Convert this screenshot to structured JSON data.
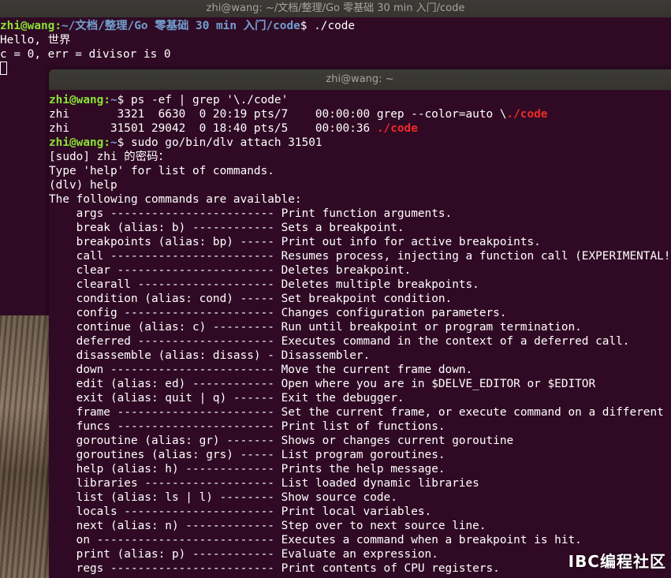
{
  "back_window": {
    "title": "zhi@wang: ~/文档/整理/Go 零基础 30 min 入门/code",
    "prompt_user": "zhi@wang",
    "prompt_path": "~/文档/整理/Go 零基础 30 min 入门/code",
    "command": " ./code",
    "output": [
      "Hello, 世界",
      "c = 0, err = divisor is 0"
    ]
  },
  "front_window": {
    "title": "zhi@wang: ~",
    "prompt_user": "zhi@wang",
    "prompt_path": "~",
    "cmd1": " ps -ef | grep '\\./code'",
    "ps_row1_prefix": "zhi       3321  6630  0 20:19 pts/7    00:00:00 grep --color=auto \\",
    "ps_row1_match": "./code",
    "ps_row2_prefix": "zhi      31501 29042  0 18:40 pts/5    00:00:36 ",
    "ps_row2_match": "./code",
    "cmd2": " sudo go/bin/dlv attach 31501",
    "lines": [
      "[sudo] zhi 的密码：",
      "Type 'help' for list of commands.",
      "(dlv) help",
      "The following commands are available:"
    ],
    "commands": [
      {
        "name": "args ------------------------",
        "desc": "Print function arguments."
      },
      {
        "name": "break (alias: b) ------------",
        "desc": "Sets a breakpoint."
      },
      {
        "name": "breakpoints (alias: bp) -----",
        "desc": "Print out info for active breakpoints."
      },
      {
        "name": "call ------------------------",
        "desc": "Resumes process, injecting a function call (EXPERIMENTAL!!!)"
      },
      {
        "name": "clear -----------------------",
        "desc": "Deletes breakpoint."
      },
      {
        "name": "clearall --------------------",
        "desc": "Deletes multiple breakpoints."
      },
      {
        "name": "condition (alias: cond) -----",
        "desc": "Set breakpoint condition."
      },
      {
        "name": "config ----------------------",
        "desc": "Changes configuration parameters."
      },
      {
        "name": "continue (alias: c) ---------",
        "desc": "Run until breakpoint or program termination."
      },
      {
        "name": "deferred --------------------",
        "desc": "Executes command in the context of a deferred call."
      },
      {
        "name": "disassemble (alias: disass) -",
        "desc": "Disassembler."
      },
      {
        "name": "down ------------------------",
        "desc": "Move the current frame down."
      },
      {
        "name": "edit (alias: ed) ------------",
        "desc": "Open where you are in $DELVE_EDITOR or $EDITOR"
      },
      {
        "name": "exit (alias: quit | q) ------",
        "desc": "Exit the debugger."
      },
      {
        "name": "frame -----------------------",
        "desc": "Set the current frame, or execute command on a different frame."
      },
      {
        "name": "funcs -----------------------",
        "desc": "Print list of functions."
      },
      {
        "name": "goroutine (alias: gr) -------",
        "desc": "Shows or changes current goroutine"
      },
      {
        "name": "goroutines (alias: grs) -----",
        "desc": "List program goroutines."
      },
      {
        "name": "help (alias: h) -------------",
        "desc": "Prints the help message."
      },
      {
        "name": "libraries -------------------",
        "desc": "List loaded dynamic libraries"
      },
      {
        "name": "list (alias: ls | l) --------",
        "desc": "Show source code."
      },
      {
        "name": "locals ----------------------",
        "desc": "Print local variables."
      },
      {
        "name": "next (alias: n) -------------",
        "desc": "Step over to next source line."
      },
      {
        "name": "on --------------------------",
        "desc": "Executes a command when a breakpoint is hit."
      },
      {
        "name": "print (alias: p) ------------",
        "desc": "Evaluate an expression."
      },
      {
        "name": "regs ------------------------",
        "desc": "Print contents of CPU registers."
      }
    ]
  },
  "watermark": "IBC编程社区"
}
